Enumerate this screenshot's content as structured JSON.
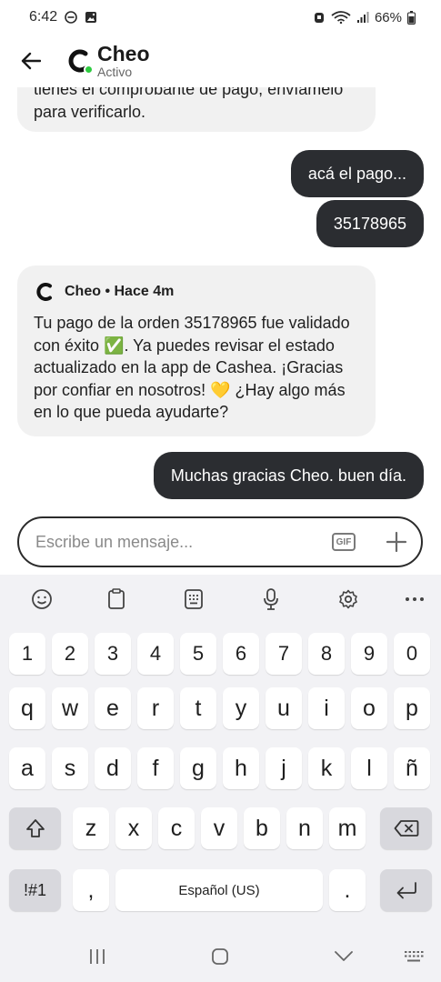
{
  "status_bar": {
    "time": "6:42",
    "battery": "66%"
  },
  "header": {
    "agent_name": "Cheo",
    "agent_status": "Activo"
  },
  "messages": {
    "partial_top_line": "tienes el comprobante de pago, envíamelo",
    "partial_bottom_line": "para verificarlo.",
    "out_1": "acá el pago...",
    "out_2": "35178965",
    "card_sender": "Cheo • Hace 4m",
    "card_text": "Tu pago de la orden 35178965 fue validado con éxito ✅. Ya puedes revisar el estado actualizado en la app de Cashea. ¡Gracias por confiar en nosotros! 💛 ¿Hay algo más en lo que pueda ayudarte?",
    "out_3": "Muchas gracias Cheo. buen día."
  },
  "composer": {
    "placeholder": "Escribe un mensaje...",
    "gif_label": "GIF"
  },
  "keyboard": {
    "toolbar": [
      "emoji-icon",
      "clipboard-icon",
      "keypad-icon",
      "microphone-icon",
      "settings-icon",
      "more-icon"
    ],
    "row_numbers": [
      "1",
      "2",
      "3",
      "4",
      "5",
      "6",
      "7",
      "8",
      "9",
      "0"
    ],
    "row_1": [
      "q",
      "w",
      "e",
      "r",
      "t",
      "y",
      "u",
      "i",
      "o",
      "p"
    ],
    "row_2": [
      "a",
      "s",
      "d",
      "f",
      "g",
      "h",
      "j",
      "k",
      "l",
      "ñ"
    ],
    "row_3": [
      "z",
      "x",
      "c",
      "v",
      "b",
      "n",
      "m"
    ],
    "symbols_label": "!#1",
    "comma_label": ",",
    "space_label": "Español (US)",
    "period_label": "."
  },
  "colors": {
    "outgoing_bubble": "#2b2d31",
    "incoming_bubble": "#f1f1f1",
    "online_dot": "#2ecc40",
    "keyboard_bg": "#f2f2f5"
  }
}
